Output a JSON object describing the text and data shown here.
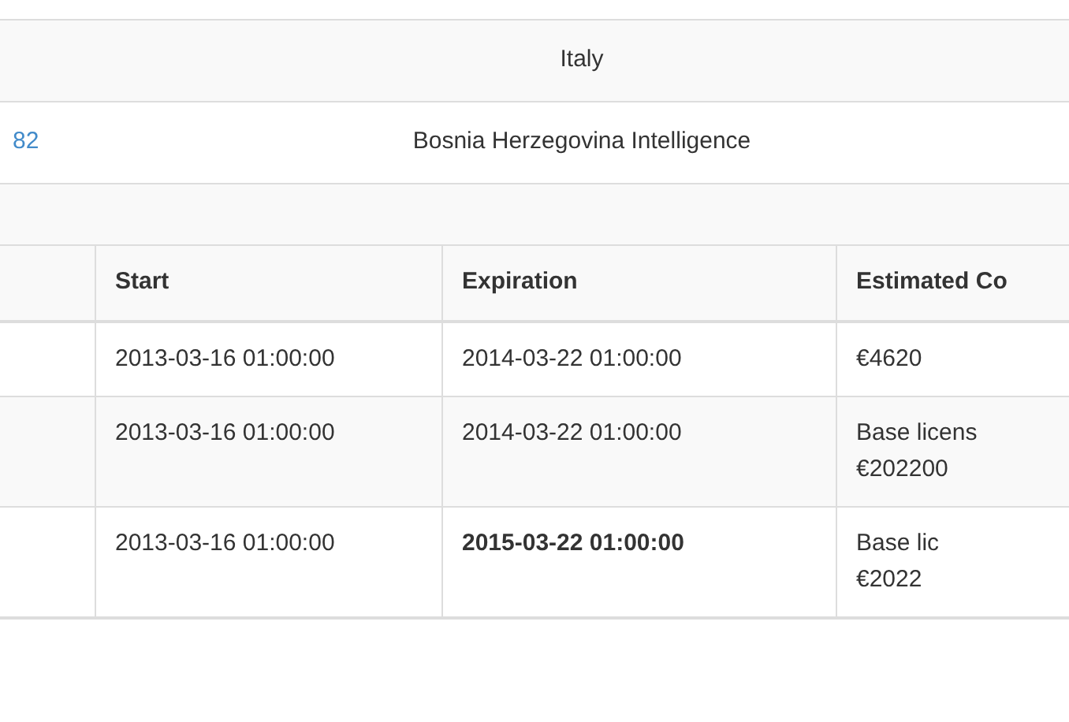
{
  "summary_rows": [
    {
      "id_link": "",
      "value": "Italy"
    },
    {
      "id_link": "82",
      "value": "Bosnia Herzegovina Intelligence"
    }
  ],
  "table": {
    "columns": [
      "Start",
      "Expiration",
      "Estimated Co"
    ],
    "rows": [
      {
        "start": "2013-03-16 01:00:00",
        "expiration": "2014-03-22 01:00:00",
        "expiration_bold": false,
        "cost_lines": [
          "€4620"
        ]
      },
      {
        "start": "2013-03-16 01:00:00",
        "expiration": "2014-03-22 01:00:00",
        "expiration_bold": false,
        "cost_lines": [
          "Base licens",
          "€202200"
        ]
      },
      {
        "start": "2013-03-16 01:00:00",
        "expiration": "2015-03-22 01:00:00",
        "expiration_bold": true,
        "cost_lines": [
          "Base lic",
          "€2022"
        ]
      }
    ]
  }
}
